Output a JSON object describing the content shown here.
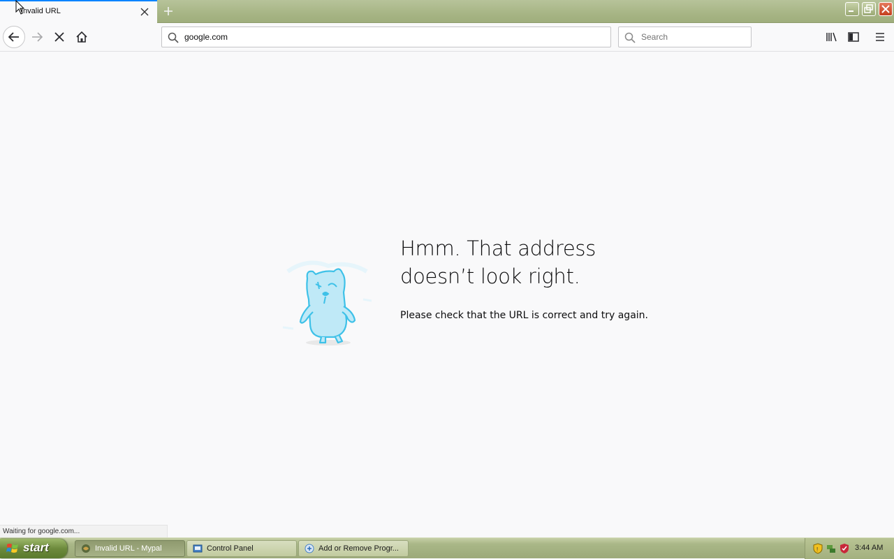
{
  "browser": {
    "tab": {
      "title": "Invalid URL",
      "close_icon": "close-icon"
    },
    "new_tab_icon": "plus-icon",
    "url": "google.com",
    "search_placeholder": "Search",
    "status_text": "Waiting for google.com..."
  },
  "page": {
    "heading": "Hmm. That address doesn’t look right.",
    "description": "Please check that the URL is correct and try again.",
    "illustration": "confused-mascot-icon"
  },
  "taskbar": {
    "start_label": "start",
    "tasks": [
      {
        "label": "Invalid URL - Mypal",
        "active": true
      },
      {
        "label": "Control Panel",
        "active": false
      },
      {
        "label": "Add or Remove Progr...",
        "active": false
      }
    ],
    "clock": "3:44 AM"
  },
  "colors": {
    "accent": "#0a84ff",
    "taskbar": "#a7b585",
    "mascot": "#3ec1e8"
  }
}
